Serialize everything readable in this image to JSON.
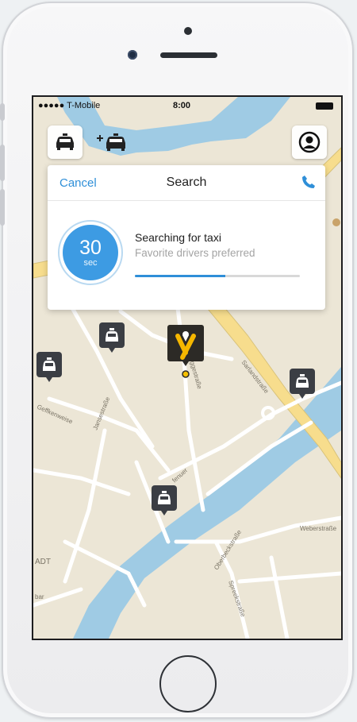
{
  "status_bar": {
    "carrier": "●●●●● T-Mobile",
    "time": "8:00"
  },
  "toolbar": {
    "taxi_icon": "taxi-icon",
    "add_taxi_icon": "add-taxi-icon",
    "profile_icon": "profile-icon"
  },
  "search_card": {
    "cancel_label": "Cancel",
    "title": "Search",
    "timer_value": "30",
    "timer_unit": "sec",
    "status_title": "Searching for taxi",
    "status_subtitle": "Favorite drivers preferred",
    "progress": 0.55
  },
  "map": {
    "labels": [
      "Sarlandstraße",
      "Geffkenweise",
      "Jansestraße",
      "Uggestraße",
      "Oberbeckstraße",
      "Weberstraße",
      "Spreekstraße",
      "ADT",
      "bar",
      "fenuer"
    ],
    "user_marker": "mytaxi-logo",
    "colors": {
      "water": "#9fcbe4",
      "road_major": "#f7dd8d",
      "land": "#ece6d6"
    }
  },
  "accent_color": "#2f8fd8"
}
